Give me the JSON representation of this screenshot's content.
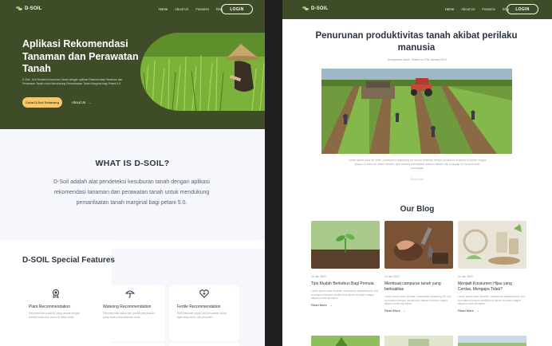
{
  "left": {
    "nav": {
      "logo": "D-SOIL",
      "links": [
        "Home",
        "About Us",
        "Features",
        "Blog"
      ],
      "login": "LOGIN"
    },
    "hero": {
      "title": "Aplikasi Rekomendasi Tanaman dan Perawatan Tanah",
      "description": "D-Soil : Soil Related Kesuburan Tanah dengan aplikasi Rekomendasi Tanaman dan Perawatan Tanah untuk Mendukung Pemanfaatan Tanah Marginal bagi Petani 5.0.",
      "cta": "Coba D-Soil Sekarang",
      "link": "About Us"
    },
    "what": {
      "title": "WHAT IS D-SOIL?",
      "text": "D-Soil  adalah alat pendeteksi kesuburan tanah dengan aplikasi rekomendasi tanaman dan perawatan tanah untuk mendukung pemanfaatan tanah marginal bagi petani 5.0."
    },
    "features": {
      "title": "D-SOIL Special Features",
      "cards": [
        {
          "title": "Plant Recommendation",
          "desc": "Rekomendasi tanaman yang sesuai dengan kondisi tanah dan cuaca di lahan anda."
        },
        {
          "title": "Watering Recommendation",
          "desc": "Rekomendasi waktu dan jumlah penyiraman yang tepat untuk tanaman anda."
        },
        {
          "title": "Fertile Recommendation",
          "desc": "Rekomendasi pupuk dan perawatan tanah agar tetap subur dan produktif."
        }
      ]
    }
  },
  "right": {
    "nav": {
      "logo": "D-SOIL",
      "links": [
        "Home",
        "About Us",
        "Features",
        "Blog"
      ],
      "login": "LOGIN"
    },
    "article": {
      "title": "Penurunan produktivitas tanah akibat perilaku manusia",
      "meta": "Anonymous Users, Posted on 27th January 2023",
      "body": "Lorem ipsum dolor sit amet, consectetur adipiscing elit sed do eiusmod tempor incididunt ut labore et dolore magna aliqua. Ut enim ad minim veniam, quis nostrud exercitation ullamco laboris nisi ut aliquip ex ea commodo consequat.",
      "read": "Read more"
    },
    "blog": {
      "title": "Our Blog",
      "posts": [
        {
          "date": "15 Jan 2023",
          "title": "Tips Mudah Berkebun Bagi Pemula",
          "desc": "Lorem ipsum dolor sit amet, consectetur adipiscing elit, sed do eiusmod tempor incididunt ut labore et dolore magna aliqua ut enim ad minim.",
          "more": "Read More"
        },
        {
          "date": "20 Jan 2023",
          "title": "Membuat campuran tanah yang berkualitas",
          "desc": "Lorem ipsum dolor sit amet, consectetur adipiscing elit, sed do eiusmod tempor incididunt ut labore et dolore magna aliqua ut enim ad minim.",
          "more": "Read More"
        },
        {
          "date": "24 Jan 2023",
          "title": "Menjadi Konsumen Hijau yang Cerdas, Mengapa Tidak?",
          "desc": "Lorem ipsum dolor sit amet, consectetur adipiscing elit, sed do eiusmod tempor incididunt ut labore et dolore magna aliqua ut enim ad minim.",
          "more": "Read More"
        }
      ]
    }
  }
}
